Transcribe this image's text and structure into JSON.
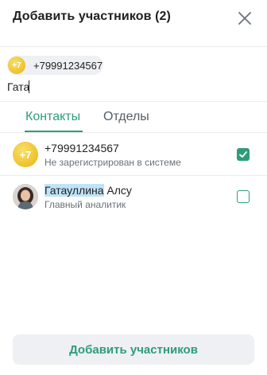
{
  "dialog": {
    "title": "Добавить участников  (2)"
  },
  "selected_chip": {
    "avatar_text": "+7",
    "label": "+79991234567"
  },
  "search": {
    "value": "Гата",
    "placeholder": ""
  },
  "tabs": [
    {
      "label": "Контакты",
      "active": true
    },
    {
      "label": "Отделы",
      "active": false
    }
  ],
  "results": [
    {
      "avatar_text": "+7",
      "name": "+79991234567",
      "subtitle": "Не зарегистрирован в системе",
      "checked": true
    },
    {
      "name_highlight": "Гатауллина",
      "name_rest": " Алсу",
      "subtitle": "Главный аналитик",
      "checked": false
    }
  ],
  "footer": {
    "submit_label": "Добавить участников"
  },
  "colors": {
    "accent": "#2e9c79",
    "highlight": "#bfe3f8",
    "avatar_yellow": "#efc633"
  }
}
